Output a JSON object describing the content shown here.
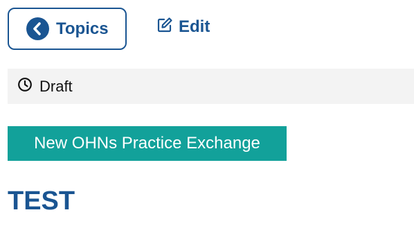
{
  "nav": {
    "back_label": "Topics",
    "back_icon": "chevron-left-icon",
    "edit_label": "Edit",
    "edit_icon": "edit-icon"
  },
  "status": {
    "label": "Draft",
    "icon": "clock-icon"
  },
  "group": {
    "label": "New OHNs Practice Exchange"
  },
  "topic": {
    "title": "TEST"
  },
  "colors": {
    "primary": "#1a5592",
    "teal": "#12a19a",
    "status_bg": "#f3f3f3"
  }
}
